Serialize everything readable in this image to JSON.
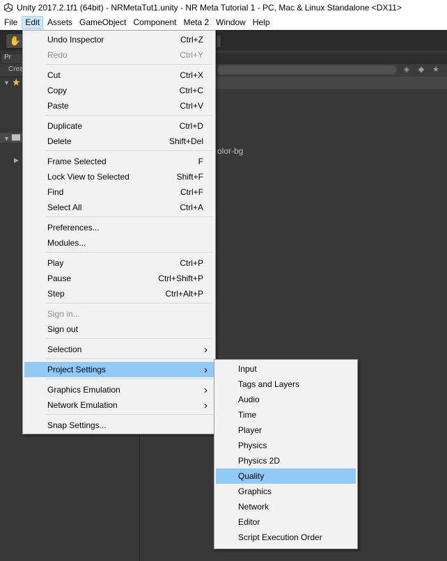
{
  "window": {
    "title": "Unity 2017.2.1f1 (64bit) - NRMetaTut1.unity - NR Meta Tutorial 1 - PC, Mac & Linux Standalone <DX11>"
  },
  "menubar": {
    "items": [
      "File",
      "Edit",
      "Assets",
      "GameObject",
      "Component",
      "Meta 2",
      "Window",
      "Help"
    ],
    "active": "Edit"
  },
  "editor": {
    "create_label": "Crea",
    "tab_label": "Pr",
    "background_text": "olor-bg"
  },
  "edit_menu": {
    "items": [
      {
        "label": "Undo Inspector",
        "shortcut": "Ctrl+Z"
      },
      {
        "label": "Redo",
        "shortcut": "Ctrl+Y",
        "disabled": true
      },
      {
        "label": "Cut",
        "shortcut": "Ctrl+X"
      },
      {
        "label": "Copy",
        "shortcut": "Ctrl+C"
      },
      {
        "label": "Paste",
        "shortcut": "Ctrl+V"
      },
      {
        "label": "Duplicate",
        "shortcut": "Ctrl+D"
      },
      {
        "label": "Delete",
        "shortcut": "Shift+Del"
      },
      {
        "label": "Frame Selected",
        "shortcut": "F"
      },
      {
        "label": "Lock View to Selected",
        "shortcut": "Shift+F"
      },
      {
        "label": "Find",
        "shortcut": "Ctrl+F"
      },
      {
        "label": "Select All",
        "shortcut": "Ctrl+A"
      },
      {
        "label": "Preferences...",
        "shortcut": ""
      },
      {
        "label": "Modules...",
        "shortcut": ""
      },
      {
        "label": "Play",
        "shortcut": "Ctrl+P"
      },
      {
        "label": "Pause",
        "shortcut": "Ctrl+Shift+P"
      },
      {
        "label": "Step",
        "shortcut": "Ctrl+Alt+P"
      },
      {
        "label": "Sign in...",
        "shortcut": "",
        "disabled": true
      },
      {
        "label": "Sign out",
        "shortcut": ""
      },
      {
        "label": "Selection",
        "shortcut": "",
        "submenu": true
      },
      {
        "label": "Project Settings",
        "shortcut": "",
        "submenu": true,
        "highlighted": true
      },
      {
        "label": "Graphics Emulation",
        "shortcut": "",
        "submenu": true
      },
      {
        "label": "Network Emulation",
        "shortcut": "",
        "submenu": true
      },
      {
        "label": "Snap Settings...",
        "shortcut": ""
      }
    ]
  },
  "project_settings_menu": {
    "items": [
      {
        "label": "Input"
      },
      {
        "label": "Tags and Layers"
      },
      {
        "label": "Audio"
      },
      {
        "label": "Time"
      },
      {
        "label": "Player"
      },
      {
        "label": "Physics"
      },
      {
        "label": "Physics 2D"
      },
      {
        "label": "Quality",
        "highlighted": true
      },
      {
        "label": "Graphics"
      },
      {
        "label": "Network"
      },
      {
        "label": "Editor"
      },
      {
        "label": "Script Execution Order"
      }
    ]
  },
  "colors": {
    "menu_highlight": "#91c9f7",
    "menubar_active": "#cce8ff",
    "editor_bg": "#383838"
  }
}
